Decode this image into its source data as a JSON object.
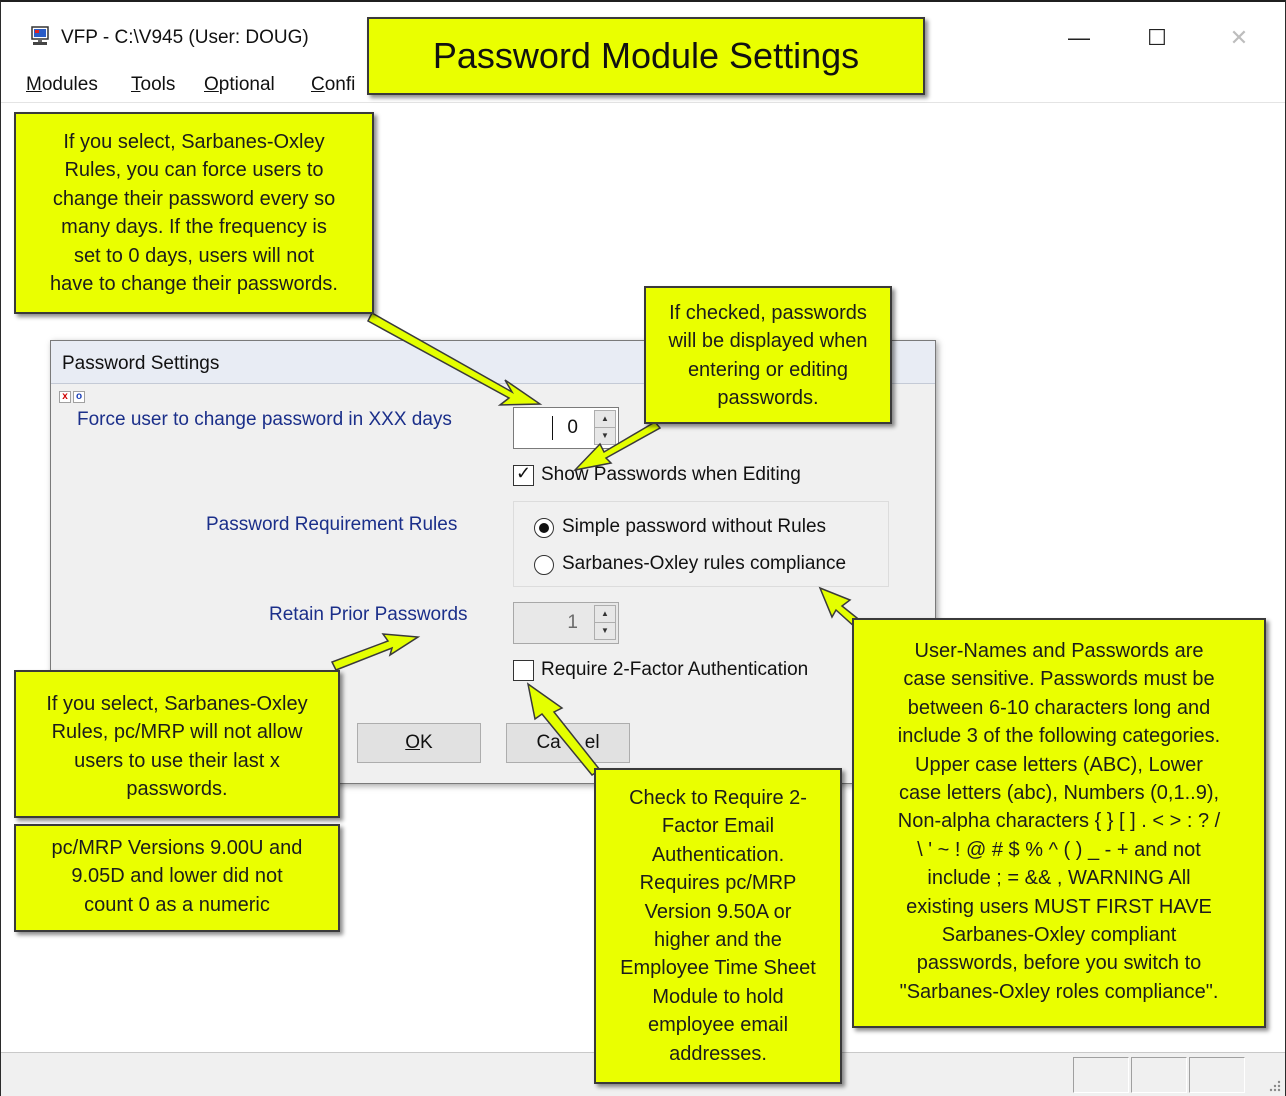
{
  "window": {
    "title": "VFP - C:\\V945  (User: DOUG)",
    "minimize_glyph": "—",
    "maximize_glyph": "☐",
    "close_glyph": "✕"
  },
  "menubar": {
    "items": [
      {
        "underline": "M",
        "rest": "odules"
      },
      {
        "underline": "T",
        "rest": "ools"
      },
      {
        "underline": "O",
        "rest": "ptional"
      },
      {
        "underline": "C",
        "rest": "onfi"
      }
    ]
  },
  "dialog": {
    "title": "Password Settings",
    "mini_x": "x",
    "mini_o": "o",
    "force_label": "Force user to change password in XXX days",
    "force_value": "0",
    "show_passwords_label": "Show Passwords when Editing",
    "show_passwords_checked": true,
    "rules_label": "Password Requirement Rules",
    "rule_options": [
      "Simple password without Rules",
      "Sarbanes-Oxley rules compliance"
    ],
    "rule_selected": 0,
    "retain_label": "Retain Prior Passwords",
    "retain_value": "1",
    "twofactor_label": "Require 2-Factor Authentication",
    "twofactor_checked": false,
    "ok_underline": "O",
    "ok_rest": "K",
    "cancel_a": "Ca",
    "cancel_b": "el"
  },
  "callouts": {
    "title": "Password Module Settings",
    "sox_force": [
      "If you select, Sarbanes-Oxley",
      "Rules, you can force users to",
      "change their password every so",
      "many days.   If the frequency is",
      "set to 0 days, users will not",
      "have to change their passwords."
    ],
    "show_pw": [
      "If checked, passwords",
      "will be displayed when",
      "entering or editing",
      "passwords."
    ],
    "sox_retain": [
      "If you select, Sarbanes-Oxley",
      "Rules, pc/MRP will not allow",
      "users to use their last x",
      "passwords."
    ],
    "versions": [
      "pc/MRP Versions 9.00U and",
      "9.05D and lower did not",
      "count 0 as a numeric"
    ],
    "twofactor": [
      "Check to Require 2-",
      "Factor Email",
      "Authentication.",
      "Requires pc/MRP",
      "Version 9.50A or",
      "higher and the",
      "Employee Time Sheet",
      "Module to hold",
      "employee email",
      "addresses."
    ],
    "case": [
      "User-Names and Passwords are",
      "case sensitive. Passwords must be",
      "between 6-10 characters long and",
      "include 3 of  the following categories.",
      "Upper case  letters (ABC), Lower",
      "case letters (abc), Numbers (0,1..9),",
      "Non-alpha characters { } [ ] . < > : ? /",
      "\\ ' ~ ! @ # $ % ^ ( ) _ - + and not",
      "include ; = && ,    WARNING All",
      "existing users MUST FIRST HAVE",
      "Sarbanes-Oxley compliant",
      "passwords, before you switch to",
      "\"Sarbanes-Oxley roles compliance\"."
    ]
  },
  "colors": {
    "callout": "#eaff00",
    "label_blue": "#1b2f8a"
  }
}
